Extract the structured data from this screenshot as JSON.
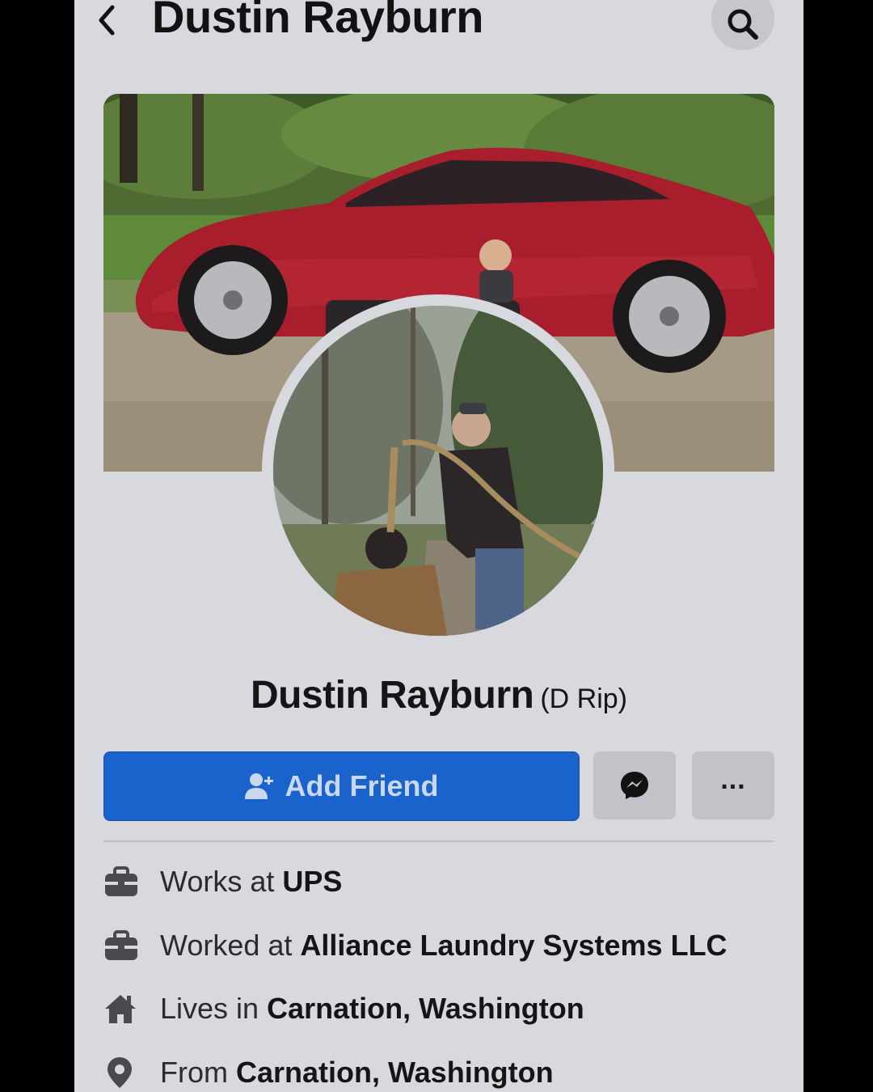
{
  "header": {
    "title": "Dustin Rayburn",
    "back_icon": "chevron-left-icon",
    "search_icon": "search-icon"
  },
  "profile": {
    "name": "Dustin Rayburn",
    "nickname": "(D Rip)"
  },
  "actions": {
    "add_friend_label": "Add Friend",
    "add_friend_icon": "add-person-icon",
    "messenger_icon": "messenger-icon",
    "more_label": "..."
  },
  "details": [
    {
      "icon": "briefcase-icon",
      "prefix": "Works at",
      "value": "UPS"
    },
    {
      "icon": "briefcase-icon",
      "prefix": "Worked at",
      "value": "Alliance Laundry Systems LLC"
    },
    {
      "icon": "home-icon",
      "prefix": "Lives in",
      "value": "Carnation, Washington"
    },
    {
      "icon": "location-pin-icon",
      "prefix": "From",
      "value": "Carnation, Washington"
    }
  ],
  "colors": {
    "background": "#d8d9de",
    "primary_button": "#1a63cc",
    "secondary_button": "#c2c3c8",
    "text": "#151515"
  }
}
